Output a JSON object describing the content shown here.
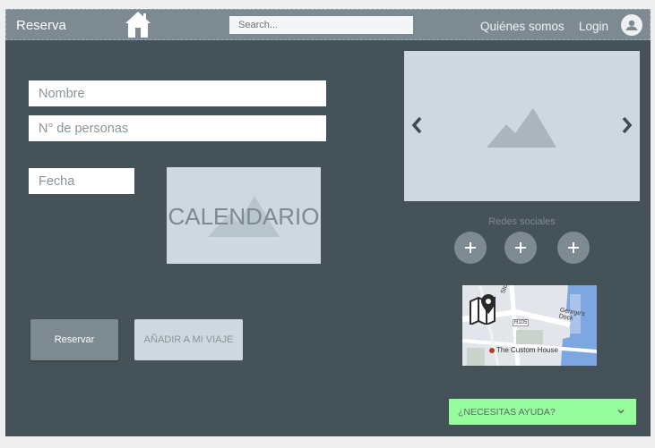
{
  "header": {
    "brand": "Reserva",
    "search_placeholder": "Search...",
    "nav": {
      "about": "Quiénes somos",
      "login": "Login"
    }
  },
  "form": {
    "name_placeholder": "Nombre",
    "people_placeholder": "N° de personas",
    "date_placeholder": "Fecha",
    "calendar_label": "CALENDARIO",
    "reserve_button": "Reservar",
    "add_trip_button": "AÑADIR A MI VIAJE"
  },
  "social": {
    "title": "Redes sociales",
    "buttons": [
      "+",
      "+",
      "+"
    ]
  },
  "map": {
    "place_label": "The Custom House",
    "street_labels": [
      "George's Dock",
      "Store St",
      "R105"
    ]
  },
  "help": {
    "label": "¿NECESITAS AYUDA?"
  },
  "icons": {
    "home": "home-icon",
    "avatar": "user-icon",
    "carousel_prev": "chevron-left-icon",
    "carousel_next": "chevron-right-icon",
    "image_placeholder": "image-placeholder-icon",
    "map": "map-pin-icon",
    "help_toggle": "chevron-down-icon"
  },
  "colors": {
    "page_bg": "#455257",
    "header_bg": "#7d8a91",
    "placeholder_bg": "#cfd8df",
    "help_bg": "#96fc9e"
  }
}
